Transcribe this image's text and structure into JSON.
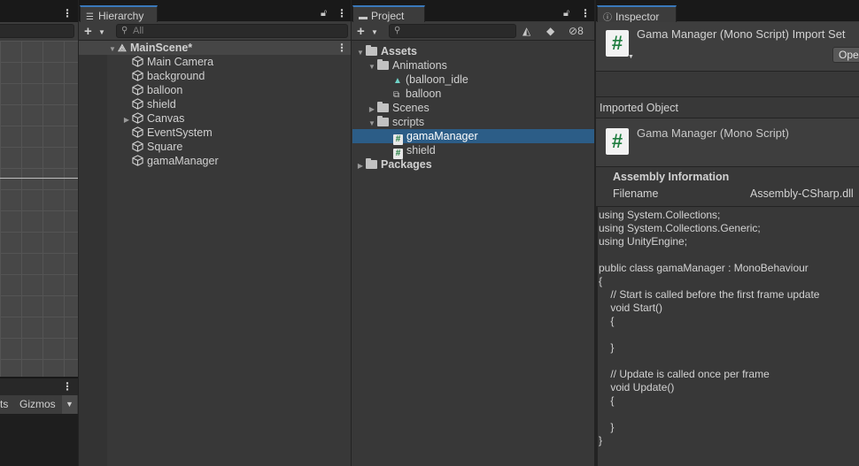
{
  "scene_panel": {
    "bottom_labels": [
      "ts",
      "Gizmos"
    ]
  },
  "hierarchy": {
    "tab": "Hierarchy",
    "search_placeholder": "All",
    "scene": "MainScene*",
    "items": [
      {
        "label": "Main Camera",
        "expandable": false
      },
      {
        "label": "background",
        "expandable": false
      },
      {
        "label": "balloon",
        "expandable": false
      },
      {
        "label": "shield",
        "expandable": false
      },
      {
        "label": "Canvas",
        "expandable": true
      },
      {
        "label": "EventSystem",
        "expandable": false
      },
      {
        "label": "Square",
        "expandable": false
      },
      {
        "label": "gamaManager",
        "expandable": false
      }
    ]
  },
  "project": {
    "tab": "Project",
    "hidden_count": "8",
    "tree": {
      "assets": "Assets",
      "animations": "Animations",
      "anim_items": [
        "(balloon_idle",
        "balloon"
      ],
      "scenes": "Scenes",
      "scripts": "scripts",
      "script_items": [
        "gamaManager",
        "shield"
      ],
      "packages": "Packages"
    }
  },
  "inspector": {
    "tab": "Inspector",
    "header_title": "Gama Manager (Mono Script) Import Set",
    "open_button": "Ope",
    "imported_object_label": "Imported Object",
    "object_title": "Gama Manager (Mono Script)",
    "assembly_info_label": "Assembly Information",
    "filename_label": "Filename",
    "filename_value": "Assembly-CSharp.dll",
    "code_lines": [
      "using System.Collections;",
      "using System.Collections.Generic;",
      "using UnityEngine;",
      "",
      "public class gamaManager : MonoBehaviour",
      "{",
      "    // Start is called before the first frame update",
      "    void Start()",
      "    {",
      "",
      "    }",
      "",
      "    // Update is called once per frame",
      "    void Update()",
      "    {",
      "",
      "    }",
      "}"
    ]
  }
}
